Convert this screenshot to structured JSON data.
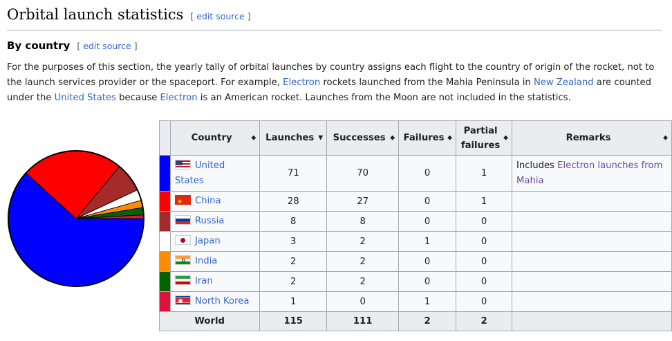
{
  "section": {
    "title": "Orbital launch statistics",
    "edit_bracket_open": "[",
    "edit_label": "edit source",
    "edit_bracket_close": "]"
  },
  "subsection": {
    "title": "By country",
    "edit_bracket_open": "[",
    "edit_label": "edit source",
    "edit_bracket_close": "]"
  },
  "paragraph": {
    "t1": "For the purposes of this section, the yearly tally of orbital launches by country assigns each flight to the country of origin of the rocket, not to the launch services provider or the spaceport. For example, ",
    "link1": "Electron",
    "t2": " rockets launched from the Mahia Peninsula in ",
    "link2": "New Zealand",
    "t3": " are counted under the ",
    "link3": "United States",
    "t4": " because ",
    "link4": "Electron",
    "t5": " is an American rocket. Launches from the Moon are not included in the statistics."
  },
  "table": {
    "headers": {
      "country": "Country",
      "launches": "Launches",
      "successes": "Successes",
      "failures": "Failures",
      "partial_line1": "Partial",
      "partial_line2": "failures",
      "remarks": "Remarks"
    },
    "sort_icons": {
      "unsorted": "◆",
      "sorted_desc": "▼"
    },
    "rows": [
      {
        "country": "United States",
        "color": "#0000ff",
        "flag": "us-flag-icon",
        "launches": "71",
        "successes": "70",
        "failures": "0",
        "partial": "1",
        "remarks_prefix": "Includes ",
        "remarks_link": "Electron launches from Mahia"
      },
      {
        "country": "China",
        "color": "#ff0000",
        "flag": "cn-flag-icon",
        "launches": "28",
        "successes": "27",
        "failures": "0",
        "partial": "1"
      },
      {
        "country": "Russia",
        "color": "#a52a2a",
        "flag": "ru-flag-icon",
        "launches": "8",
        "successes": "8",
        "failures": "0",
        "partial": "0"
      },
      {
        "country": "Japan",
        "color": "#ffffff",
        "flag": "jp-flag-icon",
        "launches": "3",
        "successes": "2",
        "failures": "1",
        "partial": "0"
      },
      {
        "country": "India",
        "color": "#ff8c00",
        "flag": "in-flag-icon",
        "launches": "2",
        "successes": "2",
        "failures": "0",
        "partial": "0"
      },
      {
        "country": "Iran",
        "color": "#006400",
        "flag": "ir-flag-icon",
        "launches": "2",
        "successes": "2",
        "failures": "0",
        "partial": "0"
      },
      {
        "country": "North Korea",
        "color": "#dc143c",
        "flag": "kp-flag-icon",
        "launches": "1",
        "successes": "0",
        "failures": "1",
        "partial": "0"
      }
    ],
    "total": {
      "label": "World",
      "launches": "115",
      "successes": "111",
      "failures": "2",
      "partial": "2"
    }
  },
  "chart_data": {
    "type": "pie",
    "title": "",
    "categories": [
      "United States",
      "China",
      "Russia",
      "Japan",
      "India",
      "Iran",
      "North Korea"
    ],
    "values": [
      71,
      28,
      8,
      3,
      2,
      2,
      1
    ],
    "colors": [
      "#0000ff",
      "#ff0000",
      "#a52a2a",
      "#ffffff",
      "#ff8c00",
      "#006400",
      "#dc143c"
    ],
    "legend": "none"
  }
}
